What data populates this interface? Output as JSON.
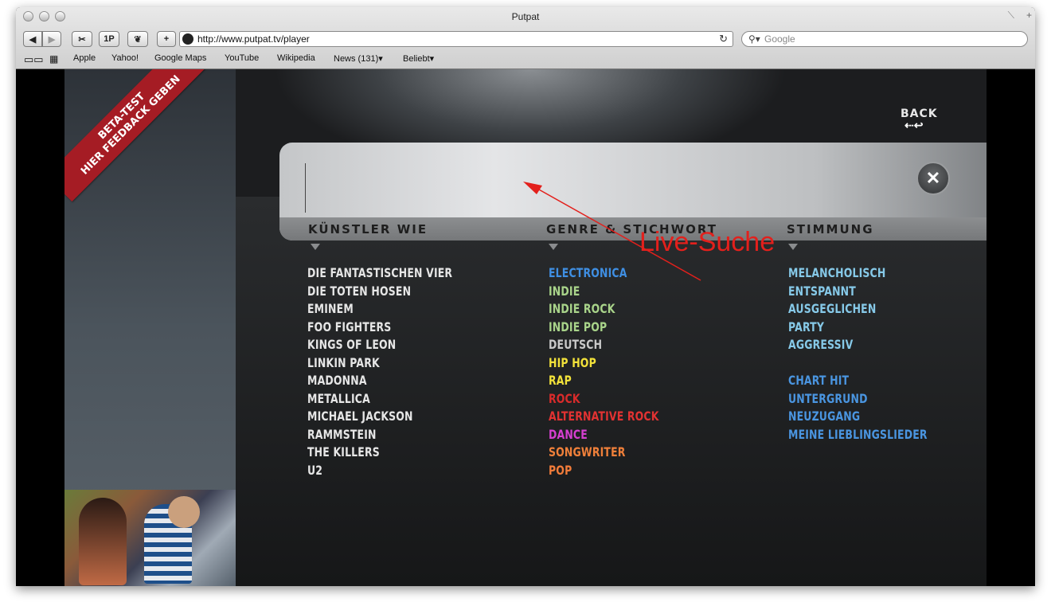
{
  "window": {
    "title": "Putpat"
  },
  "toolbar": {
    "onep_label": "1P",
    "add_label": "+",
    "url": "http://www.putpat.tv/player",
    "search_placeholder": "Google"
  },
  "bookmarks": [
    {
      "label": "Apple"
    },
    {
      "label": "Yahoo!"
    },
    {
      "label": "Google Maps"
    },
    {
      "label": "YouTube"
    },
    {
      "label": "Wikipedia"
    },
    {
      "label": "News (131)▾"
    },
    {
      "label": "Beliebt▾"
    }
  ],
  "sidebar": {
    "ribbon_line1": "BETA-TEST",
    "ribbon_line2": "HIER FEEDBACK GEBEN"
  },
  "player": {
    "back_label": "BACK",
    "search_value": "",
    "columns": {
      "artists": {
        "header": "KÜNSTLER  WIE",
        "items": [
          {
            "label": "DIE FANTASTISCHEN VIER",
            "color": "#e6e6e6"
          },
          {
            "label": "DIE TOTEN HOSEN",
            "color": "#e6e6e6"
          },
          {
            "label": "EMINEM",
            "color": "#e6e6e6"
          },
          {
            "label": "FOO FIGHTERS",
            "color": "#e6e6e6"
          },
          {
            "label": "KINGS OF LEON",
            "color": "#e6e6e6"
          },
          {
            "label": "LINKIN PARK",
            "color": "#e6e6e6"
          },
          {
            "label": "MADONNA",
            "color": "#e6e6e6"
          },
          {
            "label": "METALLICA",
            "color": "#e6e6e6"
          },
          {
            "label": "MICHAEL JACKSON",
            "color": "#e6e6e6"
          },
          {
            "label": "RAMMSTEIN",
            "color": "#e6e6e6"
          },
          {
            "label": "THE KILLERS",
            "color": "#e6e6e6"
          },
          {
            "label": "U2",
            "color": "#e6e6e6"
          }
        ]
      },
      "genres": {
        "header": "GENRE & STICHWORT",
        "items": [
          {
            "label": "ELECTRONICA",
            "color": "#3f8fe3"
          },
          {
            "label": "INDIE",
            "color": "#a9d48a"
          },
          {
            "label": "INDIE ROCK",
            "color": "#a9d48a"
          },
          {
            "label": "INDIE POP",
            "color": "#a9d48a"
          },
          {
            "label": "DEUTSCH",
            "color": "#c9c9c9"
          },
          {
            "label": "HIP HOP",
            "color": "#f2e23a"
          },
          {
            "label": "RAP",
            "color": "#f2e23a"
          },
          {
            "label": "ROCK",
            "color": "#d92b2b"
          },
          {
            "label": "ALTERNATIVE ROCK",
            "color": "#e23232"
          },
          {
            "label": "DANCE",
            "color": "#d53fd0"
          },
          {
            "label": "SONGWRITER",
            "color": "#f0803a"
          },
          {
            "label": "POP",
            "color": "#f27c3a"
          }
        ]
      },
      "moods": {
        "header": "STIMMUNG",
        "items": [
          {
            "label": "MELANCHOLISCH",
            "color": "#86c9e8"
          },
          {
            "label": "ENTSPANNT",
            "color": "#86c9e8"
          },
          {
            "label": "AUSGEGLICHEN",
            "color": "#86c9e8"
          },
          {
            "label": "PARTY",
            "color": "#86c9e8"
          },
          {
            "label": "AGGRESSIV",
            "color": "#86c9e8"
          }
        ],
        "items2": [
          {
            "label": "CHART HIT",
            "color": "#4a95e0"
          },
          {
            "label": "UNTERGRUND",
            "color": "#4a95e0"
          },
          {
            "label": "NEUZUGANG",
            "color": "#4a95e0"
          },
          {
            "label": "MEINE LIEBLINGSLIEDER",
            "color": "#4a95e0"
          }
        ]
      }
    }
  },
  "annotation": {
    "text": "Live-Suche",
    "color": "#e3201c"
  }
}
